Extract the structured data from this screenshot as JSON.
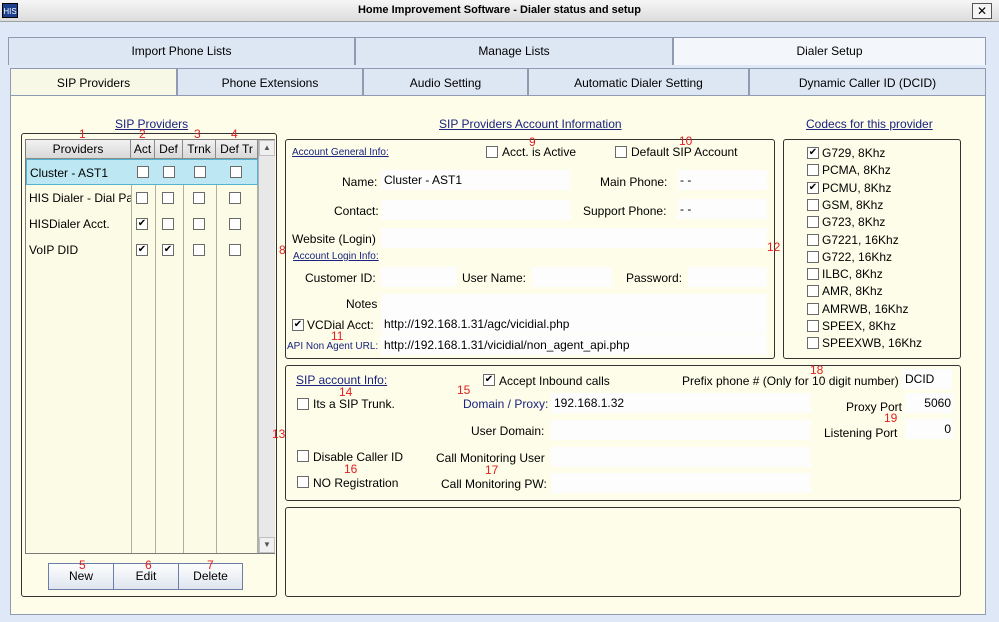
{
  "window": {
    "title": "Home Improvement Software - Dialer status and setup",
    "icon_text": "HIS",
    "close_glyph": "✕"
  },
  "top_tabs": [
    "Import Phone Lists",
    "Manage Lists",
    "Dialer Setup"
  ],
  "sub_tabs": [
    "SIP Providers",
    "Phone Extensions",
    "Audio Setting",
    "Automatic Dialer Setting",
    "Dynamic Caller ID (DCID)"
  ],
  "left": {
    "title": "SIP Providers",
    "headers": [
      "Providers",
      "Act",
      "Def",
      "Trnk",
      "Def Tr"
    ],
    "rows": [
      {
        "name": "Cluster - AST1",
        "act": false,
        "def": false,
        "trnk": false,
        "deftr": false
      },
      {
        "name": "HIS Dialer - Dial Pa",
        "act": false,
        "def": false,
        "trnk": false,
        "deftr": false
      },
      {
        "name": "HISDialer Acct.",
        "act": true,
        "def": false,
        "trnk": false,
        "deftr": false
      },
      {
        "name": "VoIP DID",
        "act": true,
        "def": true,
        "trnk": false,
        "deftr": false
      }
    ],
    "buttons": {
      "new": "New",
      "edit": "Edit",
      "delete": "Delete"
    }
  },
  "account": {
    "title": "SIP Providers Account Information",
    "general_label": "Account General Info:",
    "active_label": "Acct. is Active",
    "default_label": "Default SIP Account",
    "name_label": "Name:",
    "name_value": "Cluster - AST1",
    "main_phone_label": "Main Phone:",
    "main_phone_value": "-   -",
    "contact_label": "Contact:",
    "contact_value": "",
    "support_phone_label": "Support Phone:",
    "support_phone_value": "-   -",
    "website_label": "Website (Login)",
    "login_info_label": "Account Login Info:",
    "customer_id_label": "Customer ID:",
    "user_name_label": "User Name:",
    "password_label": "Password:",
    "notes_label": "Notes",
    "vcdial_label": "VCDial Acct:",
    "vcdial_checked": true,
    "vcdial_value": "http://192.168.1.31/agc/vicidial.php",
    "api_label": "API Non Agent URL:",
    "api_value": "http://192.168.1.31/vicidial/non_agent_api.php"
  },
  "codecs": {
    "title": "Codecs for this provider",
    "items": [
      {
        "label": "G729, 8Khz",
        "checked": true
      },
      {
        "label": "PCMA, 8Khz",
        "checked": false
      },
      {
        "label": "PCMU, 8Khz",
        "checked": true
      },
      {
        "label": "GSM, 8Khz",
        "checked": false
      },
      {
        "label": "G723, 8Khz",
        "checked": false
      },
      {
        "label": "G7221, 16Khz",
        "checked": false
      },
      {
        "label": "G722, 16Khz",
        "checked": false
      },
      {
        "label": "ILBC, 8Khz",
        "checked": false
      },
      {
        "label": "AMR, 8Khz",
        "checked": false
      },
      {
        "label": "AMRWB, 16Khz",
        "checked": false
      },
      {
        "label": "SPEEX, 8Khz",
        "checked": false
      },
      {
        "label": "SPEEXWB, 16Khz",
        "checked": false
      }
    ]
  },
  "sip": {
    "title": "SIP account Info:",
    "accept_inbound_label": "Accept Inbound calls",
    "accept_inbound_checked": true,
    "prefix_label": "Prefix phone # (Only for 10 digit number)",
    "prefix_value": "DCID",
    "trunk_label": "Its a SIP Trunk.",
    "domain_label": "Domain / Proxy:",
    "domain_value": "192.168.1.32",
    "proxy_port_label": "Proxy Port",
    "proxy_port_value": "5060",
    "user_domain_label": "User Domain:",
    "listening_port_label": "Listening Port",
    "listening_port_value": "0",
    "disable_callerid_label": "Disable Caller ID",
    "call_mon_user_label": "Call Monitoring User",
    "no_registration_label": "NO Registration",
    "call_mon_pw_label": "Call Monitoring PW:"
  },
  "markers": [
    "1",
    "2",
    "3",
    "4",
    "5",
    "6",
    "7",
    "8",
    "9",
    "10",
    "11",
    "12",
    "13",
    "14",
    "15",
    "16",
    "17",
    "18",
    "19"
  ],
  "colors": {
    "marker": "#e02020",
    "selected_row": "#bde8f3",
    "panel_bg": "#fdfde9",
    "link_blue": "#1a237e"
  }
}
